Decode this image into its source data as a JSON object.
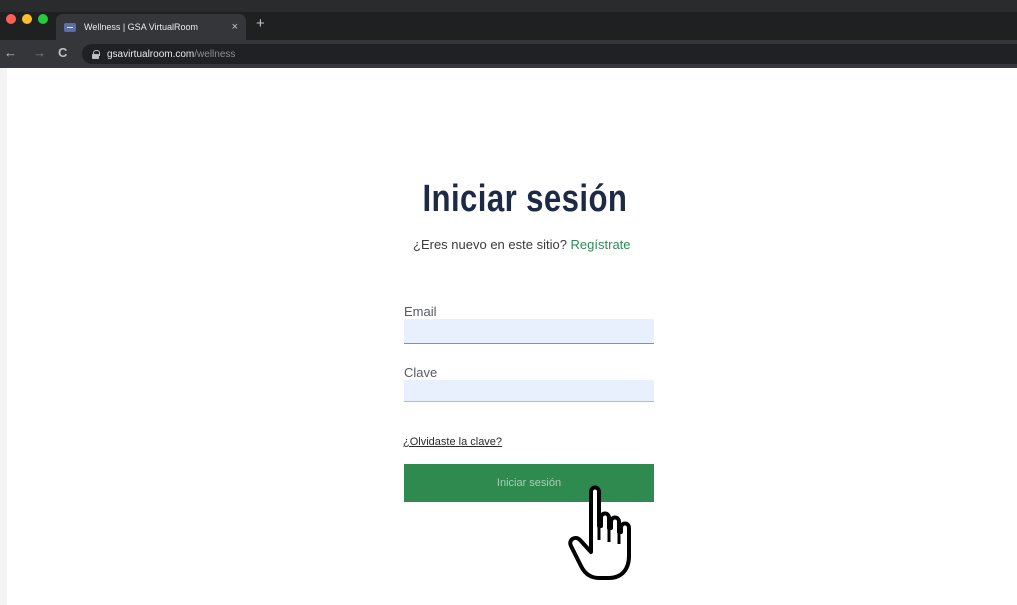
{
  "browser": {
    "tab_title": "Wellness | GSA VirtualRoom",
    "tab_close": "×",
    "new_tab": "+",
    "url_host": "gsavirtualroom.com",
    "url_path": "/wellness"
  },
  "page": {
    "heading": "Iniciar sesión",
    "new_user_prompt": "¿Eres nuevo en este sitio?",
    "register_link": "Regístrate",
    "email_label": "Email",
    "email_value": "",
    "password_label": "Clave",
    "password_value": "",
    "forgot_link": "¿Olvidaste la clave?",
    "submit_label": "Iniciar sesión",
    "accent_color": "#2f8a50"
  },
  "icons": {
    "cursor": "hand-pointer-icon"
  }
}
